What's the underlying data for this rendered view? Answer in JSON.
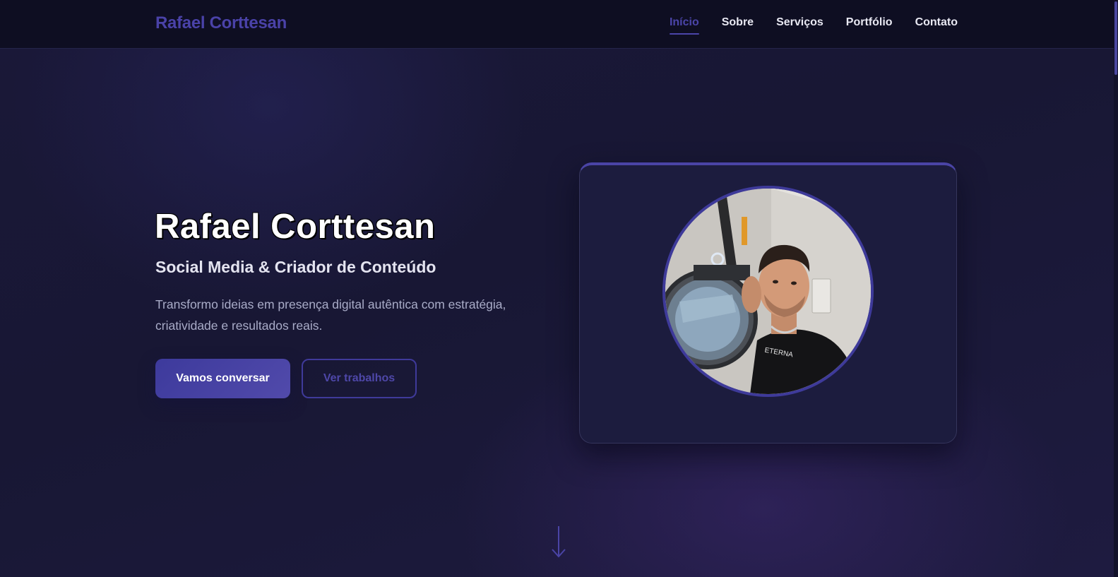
{
  "nav": {
    "brand": "Rafael Corttesan",
    "links": [
      "Início",
      "Sobre",
      "Serviços",
      "Portfólio",
      "Contato"
    ],
    "active_index": 0
  },
  "hero": {
    "title": "Rafael Corttesan",
    "subtitle": "Social Media & Criador de Conteúdo",
    "description_line1": "Transformo ideias em presença digital autêntica com estratégia,",
    "description_line2": "criatividade e resultados reais.",
    "primary_button": "Vamos conversar",
    "secondary_button": "Ver trabalhos"
  },
  "profile": {
    "photo_alt": "profile-photo"
  },
  "icons": {
    "scroll_down": "arrow-down-icon"
  },
  "colors": {
    "accent": "#4a44a6",
    "background": "#16152f",
    "card": "#1c1c3e",
    "nav": "#0e0e22"
  }
}
